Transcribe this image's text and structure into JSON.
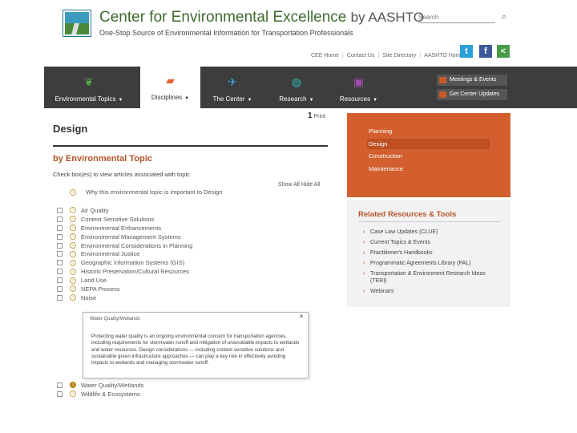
{
  "header": {
    "title": "Center for Environmental Excellence",
    "title_by": "by AASHTO",
    "subtitle": "One-Stop Source of Environmental Information for Transportation Professionals",
    "search_placeholder": "Search",
    "search_icon": "magnifier-icon",
    "util_links": [
      "CEE Home",
      "Contact Us",
      "Site Directory",
      "AASHTO Home"
    ],
    "social": [
      {
        "name": "twitter-icon",
        "glyph": "t"
      },
      {
        "name": "facebook-icon",
        "glyph": "f"
      },
      {
        "name": "share-icon",
        "glyph": "<"
      }
    ]
  },
  "nav": {
    "items": [
      {
        "label": "Environmental Topics",
        "icon": "leaf-icon",
        "color": "#5aa64a",
        "glyph": "❦",
        "active": false
      },
      {
        "label": "Disciplines",
        "icon": "folder-icon",
        "color": "#e2642e",
        "glyph": "▰",
        "active": true
      },
      {
        "label": "The Center",
        "icon": "bird-icon",
        "color": "#3aa0d8",
        "glyph": "✈",
        "active": false
      },
      {
        "label": "Research",
        "icon": "globe-icon",
        "color": "#2fb3b3",
        "glyph": "◍",
        "active": false
      },
      {
        "label": "Resources",
        "icon": "screen-icon",
        "color": "#a64ab3",
        "glyph": "▣",
        "active": false
      }
    ],
    "quick": [
      "Meetings & Events",
      "Get Center Updates"
    ]
  },
  "main": {
    "print_icon": "1",
    "print": "Print",
    "heading": "Design",
    "subheading": "by Environmental Topic",
    "instructions": "Check box(es) to view articles associated with topic",
    "show_all": "Show All",
    "hide_all": "Hide All",
    "why_text": "Why this environmental topic is important to Design",
    "topics": [
      "Air Quality",
      "Context Sensitive Solutions",
      "Environmental Enhancements",
      "Environmental Management Systems",
      "Environmental Considerations in Planning",
      "Environmental Justice",
      "Geographic Information Systems (GIS)",
      "Historic Preservation/Cultural Resources",
      "Land Use",
      "NEPA Process",
      "Noise"
    ],
    "topics_after": [
      "Water Quality/Wetlands",
      "Wildlife & Ecosystems"
    ]
  },
  "popup": {
    "title": "Water Quality/Wetlands",
    "body": "Protecting water quality is an ongoing environmental concern for transportation agencies, including requirements for stormwater runoff and mitigation of unavoidable impacts to wetlands and water resources. Design considerations — including context sensitive solutions and sustainable green infrastructure approaches — can play a key role in effectively avoiding impacts to wetlands and managing stormwater runoff."
  },
  "sidebar": {
    "disciplines": [
      "Planning",
      "Design",
      "Construction",
      "Maintenance"
    ],
    "selected": "Design",
    "resources_heading": "Related Resources & Tools",
    "resources": [
      "Case Law Updates (CLUE)",
      "Current Topics & Events",
      "Practitioner's Handbooks",
      "Programmatic Agreements Library (PAL)",
      "Transportation & Environment Research Ideas (TERI)",
      "Webinars"
    ]
  },
  "colors": {
    "accent": "#d35f2e",
    "nav_bg": "#3d3d3d",
    "title_green": "#3f6b2f"
  }
}
